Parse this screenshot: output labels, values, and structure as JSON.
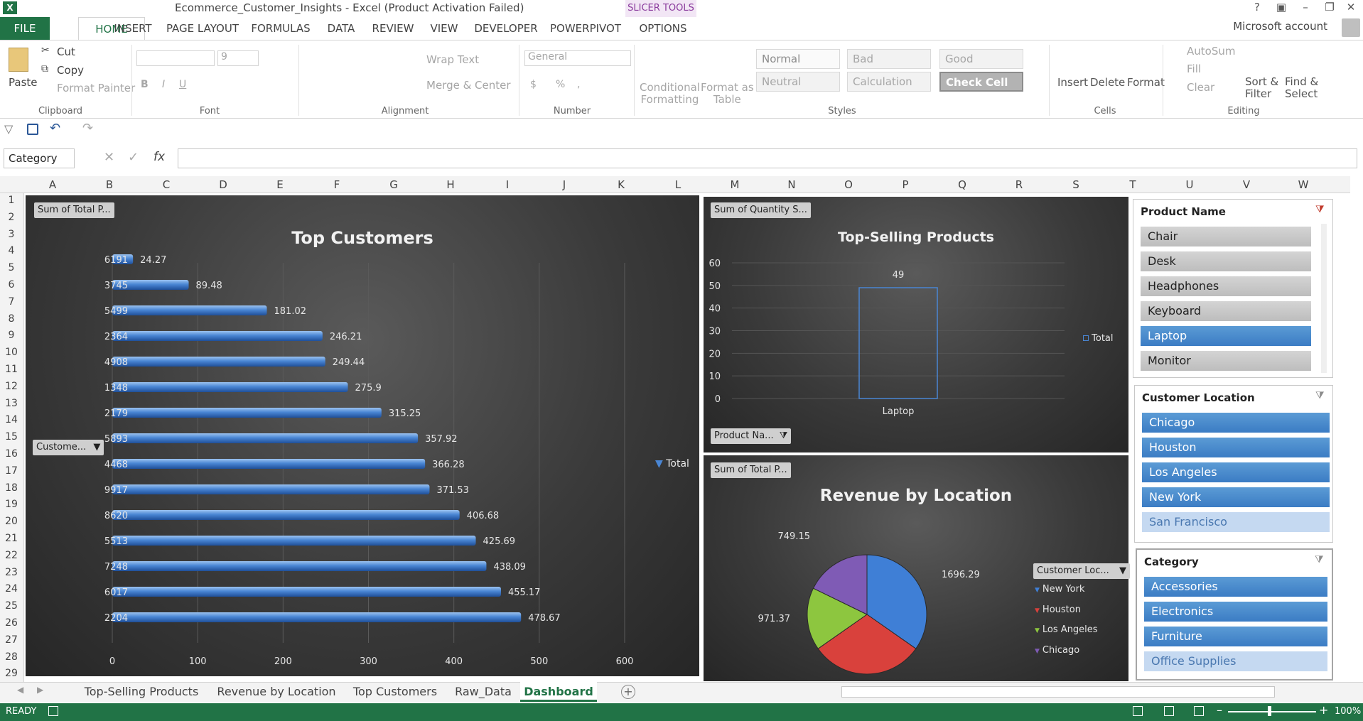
{
  "window": {
    "title": "Ecommerce_Customer_Insights - Excel (Product Activation Failed)",
    "contextual_tab_group": "SLICER TOOLS",
    "account": "Microsoft account",
    "controls": [
      "?",
      "▣",
      "–",
      "❐",
      "✕"
    ]
  },
  "ribbon_tabs": [
    "FILE",
    "HOME",
    "INSERT",
    "PAGE LAYOUT",
    "FORMULAS",
    "DATA",
    "REVIEW",
    "VIEW",
    "DEVELOPER",
    "POWERPIVOT",
    "OPTIONS"
  ],
  "clipboard": {
    "paste": "Paste",
    "cut": "Cut",
    "copy": "Copy",
    "format_painter": "Format Painter",
    "label": "Clipboard"
  },
  "font": {
    "size": "9",
    "label": "Font",
    "bold": "B",
    "italic": "I",
    "underline": "U"
  },
  "alignment": {
    "wrap_text": "Wrap Text",
    "merge_center": "Merge & Center",
    "label": "Alignment"
  },
  "number": {
    "format": "General",
    "currency": "$",
    "percent": "%",
    "comma": ",",
    "label": "Number"
  },
  "styles": {
    "conditional_formatting": [
      "Conditional",
      "Formatting"
    ],
    "format_as_table": [
      "Format as",
      "Table"
    ],
    "cells": [
      "Normal",
      "Bad",
      "Good",
      "Neutral",
      "Calculation",
      "Check Cell"
    ],
    "label": "Styles"
  },
  "cells_group": {
    "insert": "Insert",
    "delete": "Delete",
    "format": "Format",
    "label": "Cells"
  },
  "editing": {
    "autosum": "AutoSum",
    "fill": "Fill",
    "clear": "Clear",
    "sort_filter": [
      "Sort &",
      "Filter"
    ],
    "find_select": [
      "Find &",
      "Select"
    ],
    "label": "Editing"
  },
  "formula_bar": {
    "name_box": "Category",
    "fx": "fx",
    "value": ""
  },
  "columns": [
    "A",
    "B",
    "C",
    "D",
    "E",
    "F",
    "G",
    "H",
    "I",
    "J",
    "K",
    "L",
    "M",
    "N",
    "O",
    "P",
    "Q",
    "R",
    "S",
    "T",
    "U",
    "V",
    "W"
  ],
  "rows": [
    "1",
    "2",
    "3",
    "4",
    "5",
    "6",
    "7",
    "8",
    "9",
    "10",
    "11",
    "12",
    "13",
    "14",
    "15",
    "16",
    "17",
    "18",
    "19",
    "20",
    "21",
    "22",
    "23",
    "24",
    "25",
    "26",
    "27",
    "28",
    "29"
  ],
  "charts": {
    "top_customers": {
      "field_button": "Sum of Total P...",
      "axis_button": "Custome...",
      "legend": "Total"
    },
    "top_selling": {
      "field_button": "Sum of Quantity S...",
      "filter_button": "Product Na...",
      "legend": "Total"
    },
    "revenue_location": {
      "field_button": "Sum of Total P...",
      "legend_button": "Customer Loc..."
    }
  },
  "chart_data": [
    {
      "type": "bar",
      "title": "Top Customers",
      "categories": [
        "6191",
        "3745",
        "5499",
        "2364",
        "4908",
        "1348",
        "2179",
        "5893",
        "4468",
        "9917",
        "8620",
        "5513",
        "7248",
        "6017",
        "2204"
      ],
      "series": [
        {
          "name": "Total",
          "values": [
            24.27,
            89.48,
            181.02,
            246.21,
            249.44,
            275.9,
            315.25,
            357.92,
            366.28,
            371.53,
            406.68,
            425.69,
            438.09,
            455.17,
            478.67
          ]
        }
      ],
      "xlim": [
        0,
        600
      ],
      "ticks": [
        "0",
        "100",
        "200",
        "300",
        "400",
        "500",
        "600"
      ],
      "legend": "right",
      "color": "#4a86d4"
    },
    {
      "type": "bar",
      "title": "Top-Selling Products",
      "categories": [
        "Laptop"
      ],
      "series": [
        {
          "name": "Total",
          "values": [
            49
          ]
        }
      ],
      "ylim": [
        0,
        60
      ],
      "ticks": [
        "0",
        "10",
        "20",
        "30",
        "40",
        "50",
        "60"
      ],
      "grid": true,
      "legend": "right"
    },
    {
      "type": "pie",
      "title": "Revenue by Location",
      "categories": [
        "New York",
        "Houston",
        "Los Angeles",
        "Chicago"
      ],
      "values": [
        1696.29,
        null,
        971.37,
        749.15
      ],
      "value_labels": [
        "1696.29",
        "",
        "971.37",
        "749.15"
      ],
      "colors": [
        "#3f7fd6",
        "#d9413c",
        "#8dc63f",
        "#7f5bb5"
      ],
      "legend": "right"
    }
  ],
  "slicers": {
    "product": {
      "title": "Product Name",
      "items": [
        "Chair",
        "Desk",
        "Headphones",
        "Keyboard",
        "Laptop",
        "Monitor"
      ],
      "selected": [
        "Laptop"
      ]
    },
    "location": {
      "title": "Customer Location",
      "items": [
        "Chicago",
        "Houston",
        "Los Angeles",
        "New York",
        "San Francisco"
      ],
      "selected": [
        "Chicago",
        "Houston",
        "Los Angeles",
        "New York"
      ]
    },
    "category": {
      "title": "Category",
      "items": [
        "Accessories",
        "Electronics",
        "Furniture",
        "Office Supplies"
      ],
      "selected": [
        "Accessories",
        "Electronics",
        "Furniture"
      ]
    }
  },
  "sheet_tabs": [
    "Top-Selling Products",
    "Revenue by Location",
    "Top Customers",
    "Raw_Data",
    "Dashboard"
  ],
  "active_sheet": "Dashboard",
  "status": {
    "mode": "READY",
    "zoom": "100%"
  }
}
